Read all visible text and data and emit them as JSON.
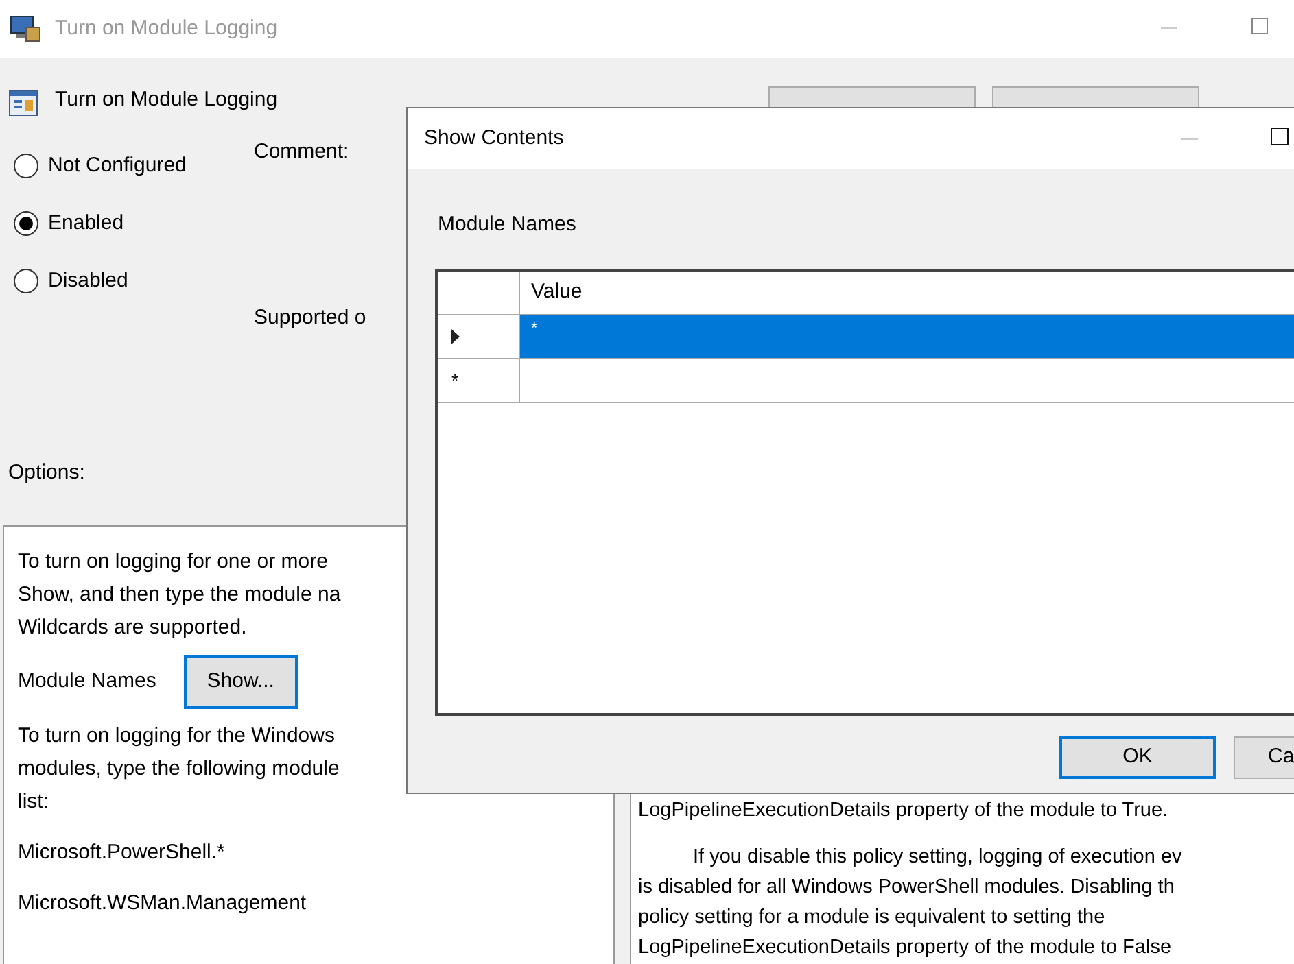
{
  "window": {
    "title": "Turn on Module Logging"
  },
  "header": {
    "title": "Turn on Module Logging"
  },
  "state_options": [
    {
      "label": "Not Configured",
      "selected": false
    },
    {
      "label": "Enabled",
      "selected": true
    },
    {
      "label": "Disabled",
      "selected": false
    }
  ],
  "comment_label": "Comment:",
  "supported_label": "Supported o",
  "options_label": "Options:",
  "options_panel": {
    "intro": "To turn on logging for one or more\nShow, and then type the module na\nWildcards are supported.",
    "module_names_label": "Module Names",
    "show_button": "Show...",
    "note": "To turn on logging for the Windows\nmodules, type the following module\nlist:",
    "modules": [
      "Microsoft.PowerShell.*",
      "Microsoft.WSMan.Management"
    ]
  },
  "help_panel": {
    "paragraphs": [
      "LogPipelineExecutionDetails property of the module to True.",
      "If you disable this policy setting, logging of execution ev\nis disabled for all Windows PowerShell modules. Disabling th\npolicy setting for a module is equivalent to setting the\nLogPipelineExecutionDetails property of the module to False"
    ]
  },
  "dialog": {
    "title": "Show Contents",
    "list_label": "Module Names",
    "columns": [
      "Value"
    ],
    "rows": [
      {
        "kind": "current",
        "value": "*",
        "selected": true
      },
      {
        "kind": "new",
        "marker": "*",
        "selected": false
      }
    ],
    "buttons": [
      {
        "label": "OK",
        "focused": true
      },
      {
        "label": "Ca",
        "focused": false
      }
    ]
  }
}
